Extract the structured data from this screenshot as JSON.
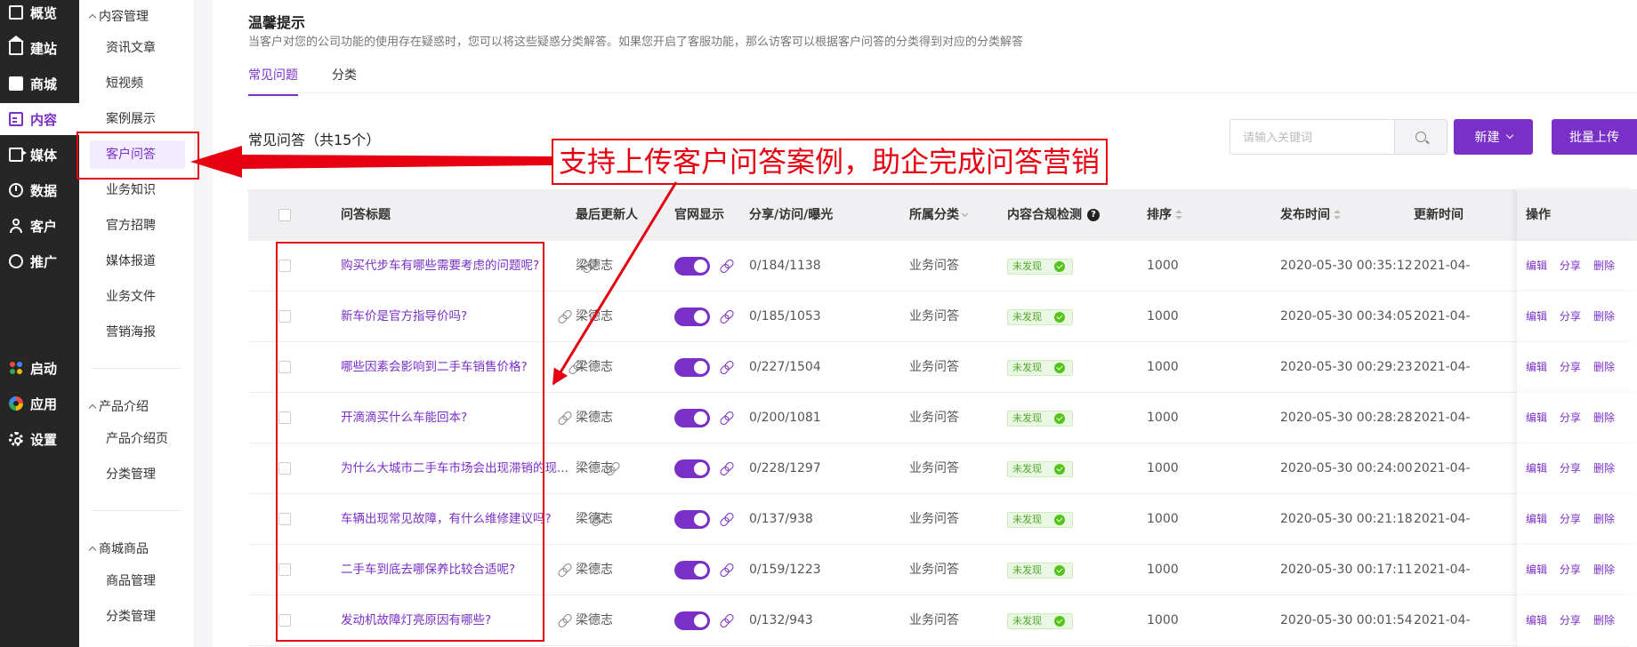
{
  "nav": {
    "items": [
      {
        "label": "概览",
        "icon": "dashboard-icon"
      },
      {
        "label": "建站",
        "icon": "home-icon"
      },
      {
        "label": "商城",
        "icon": "shop-icon"
      },
      {
        "label": "内容",
        "icon": "document-icon",
        "active": true
      },
      {
        "label": "媒体",
        "icon": "media-icon"
      },
      {
        "label": "数据",
        "icon": "data-icon"
      },
      {
        "label": "客户",
        "icon": "user-icon"
      },
      {
        "label": "推广",
        "icon": "paperclip-icon"
      },
      {
        "label": "启动",
        "icon": "launch-icon"
      },
      {
        "label": "应用",
        "icon": "app-icon"
      },
      {
        "label": "设置",
        "icon": "gear-icon"
      }
    ]
  },
  "subnav": {
    "content_group": "内容管理",
    "content_items": [
      "资讯文章",
      "短视频",
      "案例展示",
      "客户问答",
      "业务知识",
      "官方招聘",
      "媒体报道",
      "业务文件",
      "营销海报"
    ],
    "product_group": "产品介绍",
    "product_items": [
      "产品介绍页",
      "分类管理"
    ],
    "shop_group": "商城商品",
    "shop_items": [
      "商品管理",
      "分类管理"
    ]
  },
  "tip": {
    "title": "温馨提示",
    "desc": "当客户对您的公司功能的使用存在疑惑时，您可以将这些疑惑分类解答。如果您开启了客服功能，那么访客可以根据客户问答的分类得到对应的分类解答"
  },
  "tabs": [
    "常见问题",
    "分类"
  ],
  "list": {
    "title": "常见问答（共15个）",
    "search_placeholder": "请输入关键词",
    "new_label": "新建",
    "batch_label": "批量上传"
  },
  "table": {
    "headers": {
      "title": "问答标题",
      "updater": "最后更新人",
      "site_display": "官网显示",
      "stats": "分享/访问/曝光",
      "category": "所属分类",
      "compliance": "内容合规检测",
      "order": "排序",
      "publish": "发布时间",
      "update": "更新时间",
      "ops": "操作"
    },
    "badge_text": "未发现",
    "ops": [
      "编辑",
      "分享",
      "删除"
    ],
    "rows": [
      {
        "title": "购买代步车有哪些需要考虑的问题呢?",
        "updater": "梁德志",
        "stats": "0/184/1138",
        "category": "业务问答",
        "order": "1000",
        "publish": "2020-05-30 00:35:12",
        "update": "2021-04-"
      },
      {
        "title": "新车价是官方指导价吗?",
        "updater": "梁德志",
        "stats": "0/185/1053",
        "category": "业务问答",
        "order": "1000",
        "publish": "2020-05-30 00:34:05",
        "update": "2021-04-"
      },
      {
        "title": "哪些因素会影响到二手车销售价格?",
        "updater": "梁德志",
        "stats": "0/227/1504",
        "category": "业务问答",
        "order": "1000",
        "publish": "2020-05-30 00:29:23",
        "update": "2021-04-"
      },
      {
        "title": "开滴滴买什么车能回本?",
        "updater": "梁德志",
        "stats": "0/200/1081",
        "category": "业务问答",
        "order": "1000",
        "publish": "2020-05-30 00:28:28",
        "update": "2021-04-"
      },
      {
        "title": "为什么大城市二手车市场会出现滞销的现...",
        "updater": "梁德志",
        "stats": "0/228/1297",
        "category": "业务问答",
        "order": "1000",
        "publish": "2020-05-30 00:24:00",
        "update": "2021-04-"
      },
      {
        "title": "车辆出现常见故障，有什么维修建议吗?",
        "updater": "梁德志",
        "stats": "0/137/938",
        "category": "业务问答",
        "order": "1000",
        "publish": "2020-05-30 00:21:18",
        "update": "2021-04-"
      },
      {
        "title": "二手车到底去哪保养比较合适呢?",
        "updater": "梁德志",
        "stats": "0/159/1223",
        "category": "业务问答",
        "order": "1000",
        "publish": "2020-05-30 00:17:11",
        "update": "2021-04-"
      },
      {
        "title": "发动机故障灯亮原因有哪些?",
        "updater": "梁德志",
        "stats": "0/132/943",
        "category": "业务问答",
        "order": "1000",
        "publish": "2020-05-30 00:01:54",
        "update": "2021-04-"
      }
    ]
  },
  "annotation": {
    "callout": "支持上传客户问答案例，助企完成问答营销",
    "color": "#e60012"
  },
  "colors": {
    "accent": "#7a2fc6",
    "nav_bg": "#262626",
    "success": "#52c41a"
  }
}
